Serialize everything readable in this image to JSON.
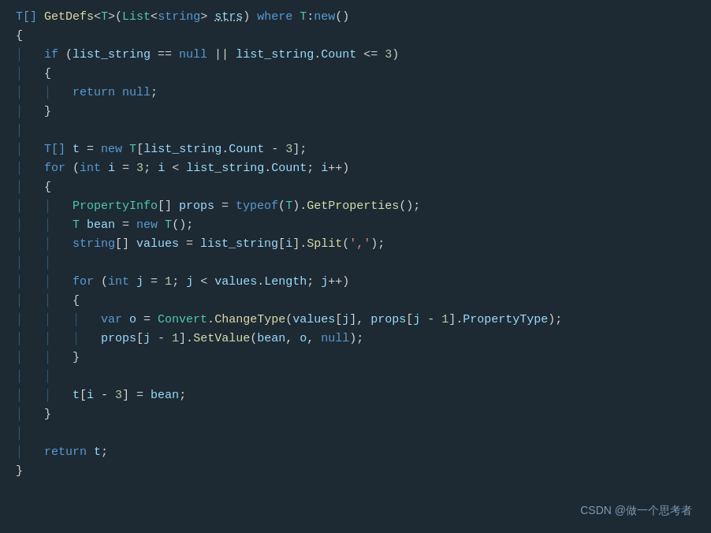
{
  "watermark": "CSDN @做一个思考者",
  "code": {
    "lines": [
      "T[] GetDefs<T>(List<string> strs) where T:new()",
      "{",
      "    if (list_string == null || list_string.Count <= 3)",
      "    {",
      "        return null;",
      "    }",
      "",
      "    T[] t = new T[list_string.Count - 3];",
      "    for (int i = 3; i < list_string.Count; i++)",
      "    {",
      "        PropertyInfo[] props = typeof(T).GetProperties();",
      "        T bean = new T();",
      "        string[] values = list_string[i].Split(',');",
      "",
      "        for (int j = 1; j < values.Length; j++)",
      "        {",
      "            var o = Convert.ChangeType(values[j], props[j - 1].PropertyType);",
      "            props[j - 1].SetValue(bean, o, null);",
      "        }",
      "",
      "        t[i - 3] = bean;",
      "    }",
      "",
      "    return t;",
      "}"
    ]
  }
}
